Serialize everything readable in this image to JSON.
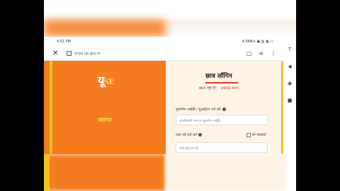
{
  "status": {
    "time": "4:51 PM",
    "icons_right": "4.0KB/s ▣ ▥ ▦ ▭"
  },
  "browser": {
    "url": "urise.up.gov.in"
  },
  "side_buttons": [
    "T",
    "◀",
    "◉",
    "■"
  ],
  "logo": {
    "main": "यू",
    "suffix": "SE"
  },
  "left_panel": {
    "welcome": "स्वागत"
  },
  "login": {
    "title": "छात्र लॉगिन",
    "register_prompt": "खाता नहीं है?",
    "register_link": "अकाउंट बनाएं",
    "userid_label": "यूज़रनेम आईडी / यूआईएन दर्ज करें",
    "userid_placeholder": "उपयोगकर्ता नाम या यूज़रनेम आईडी",
    "password_label": "पास वर्ड दर्ज करें",
    "show_label": "शो पासवर्ड",
    "password_placeholder": "पास वर्ड दर्ज करें"
  },
  "colors": {
    "orange": "#f47c1f",
    "yellow": "#f3c21c",
    "cream": "#fdf4e6",
    "accent": "#e5442a"
  }
}
